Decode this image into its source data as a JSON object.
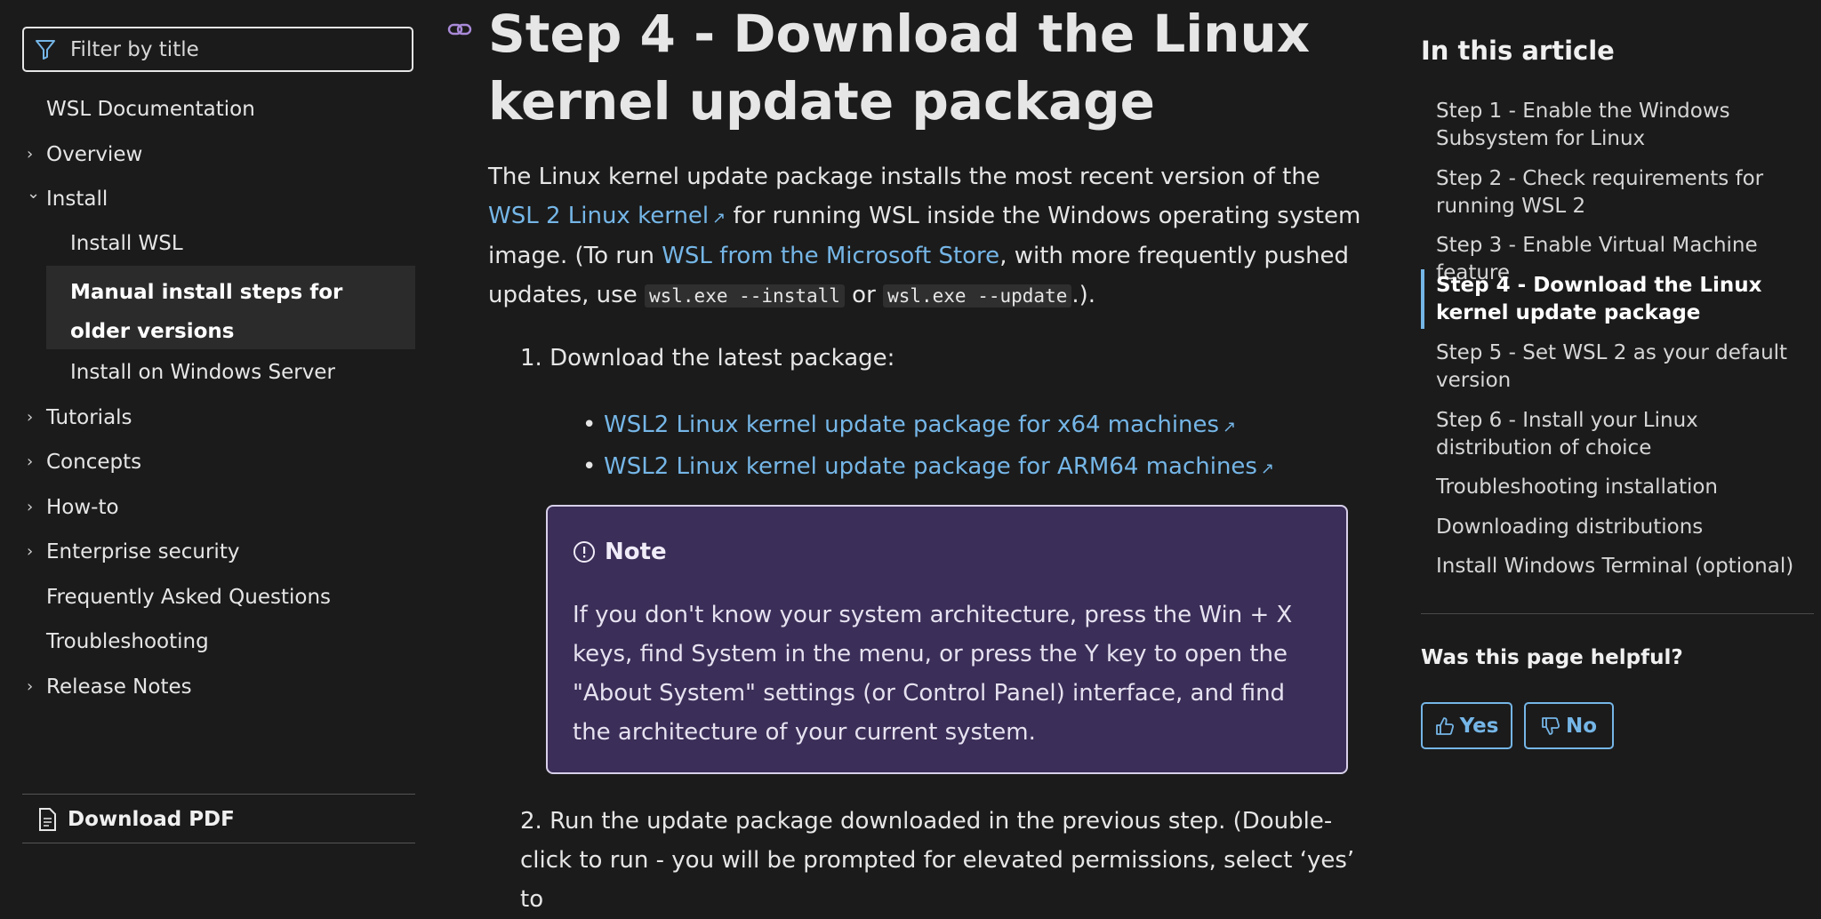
{
  "left_nav": {
    "filter_placeholder": "Filter by title",
    "items": [
      {
        "label": "WSL Documentation",
        "chevron": ""
      },
      {
        "label": "Overview",
        "chevron": "›"
      },
      {
        "label": "Install",
        "chevron": "⌄"
      },
      {
        "label": "Install WSL",
        "chevron": ""
      },
      {
        "label": "Manual install steps for older versions",
        "chevron": ""
      },
      {
        "label": "Install on Windows Server",
        "chevron": ""
      },
      {
        "label": "Tutorials",
        "chevron": "›"
      },
      {
        "label": "Concepts",
        "chevron": "›"
      },
      {
        "label": "How-to",
        "chevron": "›"
      },
      {
        "label": "Enterprise security",
        "chevron": "›"
      },
      {
        "label": "Frequently Asked Questions",
        "chevron": ""
      },
      {
        "label": "Troubleshooting",
        "chevron": ""
      },
      {
        "label": "Release Notes",
        "chevron": "›"
      }
    ],
    "download_pdf": "Download PDF"
  },
  "main": {
    "title": "Step 4 - Download the Linux kernel update package",
    "intro": {
      "part1": "The Linux kernel update package installs the most recent version of the ",
      "link1": "WSL 2 Linux kernel",
      "part2": " for running WSL inside the Windows operating system image. (To run ",
      "link2": "WSL from the Microsoft Store",
      "part3": ", with more frequently pushed updates, use ",
      "code1": "wsl.exe --install",
      "part4": " or ",
      "code2": "wsl.exe --update",
      "part5": ".)."
    },
    "step1": "1. Download the latest package:",
    "downloads": [
      "WSL2 Linux kernel update package for x64 machines",
      "WSL2 Linux kernel update package for ARM64 machines"
    ],
    "note": {
      "title": "Note",
      "body": "If you don't know your system architecture, press the Win + X keys, find System in the menu, or press the Y key to open the \"About System\" settings (or Control Panel) interface, and find the architecture of your current system."
    },
    "step2": "2. Run the update package downloaded in the previous step. (Double-click to run - you will be prompted for elevated permissions, select ‘yes’ to"
  },
  "toc": {
    "title": "In this article",
    "items": [
      "Step 1 - Enable the Windows Subsystem for Linux",
      "Step 2 - Check requirements for running WSL 2",
      "Step 3 - Enable Virtual Machine feature",
      "Step 4 - Download the Linux kernel update package",
      "Step 5 - Set WSL 2 as your default version",
      "Step 6 - Install your Linux distribution of choice",
      "Troubleshooting installation",
      "Downloading distributions",
      "Install Windows Terminal (optional)"
    ],
    "active_index": 3,
    "helpful_question": "Was this page helpful?",
    "yes_label": "Yes",
    "no_label": "No"
  },
  "colors": {
    "background": "#1b1b1b",
    "link": "#75b6e7",
    "note_background": "#3b2e58",
    "selected_nav": "#2b2b2b"
  }
}
